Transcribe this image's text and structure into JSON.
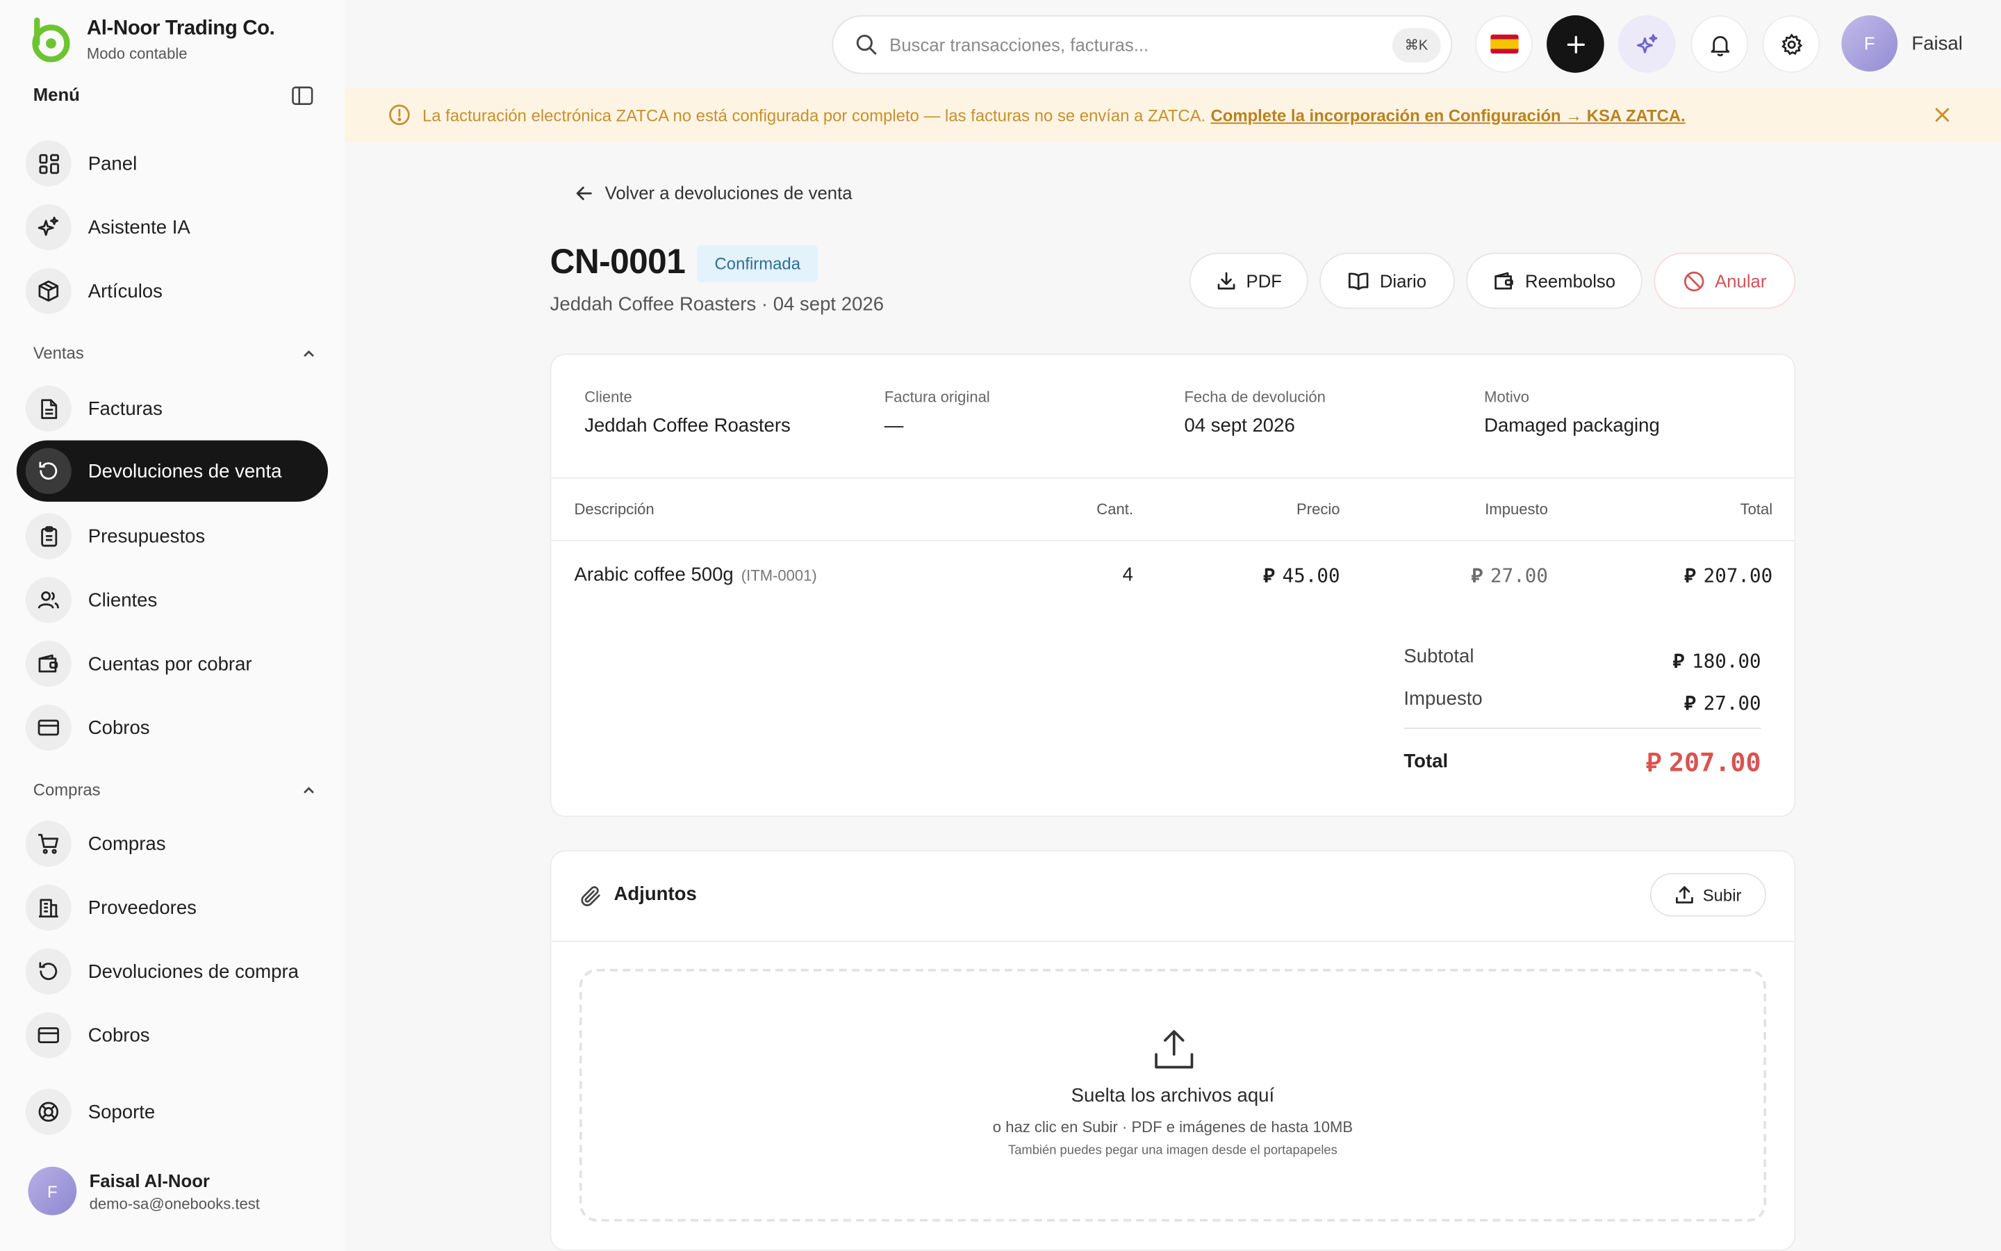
{
  "brand": {
    "name": "Al-Noor Trading Co.",
    "mode": "Modo contable"
  },
  "sidebar": {
    "menu_title": "Menú",
    "top_items": [
      {
        "label": "Panel",
        "icon": "grid-icon"
      },
      {
        "label": "Asistente IA",
        "icon": "sparkles-icon"
      },
      {
        "label": "Artículos",
        "icon": "box-icon"
      }
    ],
    "sales": {
      "title": "Ventas",
      "items": [
        {
          "label": "Facturas",
          "icon": "file-icon"
        },
        {
          "label": "Devoluciones de venta",
          "icon": "return-icon",
          "active": true
        },
        {
          "label": "Presupuestos",
          "icon": "clipboard-icon"
        },
        {
          "label": "Clientes",
          "icon": "users-icon"
        },
        {
          "label": "Cuentas por cobrar",
          "icon": "wallet-icon"
        },
        {
          "label": "Cobros",
          "icon": "card-icon"
        }
      ]
    },
    "purchases": {
      "title": "Compras",
      "items": [
        {
          "label": "Compras",
          "icon": "cart-icon"
        },
        {
          "label": "Proveedores",
          "icon": "building-icon"
        },
        {
          "label": "Devoluciones de compra",
          "icon": "return-icon"
        },
        {
          "label": "Cobros",
          "icon": "card-icon"
        }
      ]
    },
    "support": {
      "label": "Soporte",
      "icon": "lifebuoy-icon"
    },
    "user": {
      "initial": "F",
      "name": "Faisal Al-Noor",
      "email": "demo-sa@onebooks.test"
    }
  },
  "topbar": {
    "search_placeholder": "Buscar transacciones, facturas...",
    "shortcut": "⌘K",
    "profile": {
      "initial": "F",
      "name": "Faisal"
    }
  },
  "banner": {
    "text": "La facturación electrónica ZATCA no está configurada por completo — las facturas no se envían a ZATCA.",
    "link": "Complete la incorporación en Configuración → KSA ZATCA."
  },
  "doc": {
    "back": "Volver a devoluciones de venta",
    "number": "CN-0001",
    "status": "Confirmada",
    "subtitle": "Jeddah Coffee Roasters · 04 sept 2026",
    "actions": {
      "pdf": "PDF",
      "journal": "Diario",
      "refund": "Reembolso",
      "void": "Anular"
    },
    "meta": [
      {
        "label": "Cliente",
        "value": "Jeddah Coffee Roasters"
      },
      {
        "label": "Factura original",
        "value": "—"
      },
      {
        "label": "Fecha de devolución",
        "value": "04 sept 2026"
      },
      {
        "label": "Motivo",
        "value": "Damaged packaging"
      }
    ],
    "table": {
      "headers": {
        "description": "Descripción",
        "qty": "Cant.",
        "price": "Precio",
        "tax": "Impuesto",
        "total": "Total"
      },
      "rows": [
        {
          "description": "Arabic coffee 500g",
          "sku": "(ITM-0001)",
          "qty": "4",
          "price": "45.00",
          "tax": "27.00",
          "total": "207.00"
        }
      ]
    },
    "currency_symbol": "⃁",
    "totals": {
      "subtotal_label": "Subtotal",
      "subtotal": "180.00",
      "tax_label": "Impuesto",
      "tax": "27.00",
      "total_label": "Total",
      "total": "207.00"
    }
  },
  "attachments": {
    "title": "Adjuntos",
    "upload": "Subir",
    "drop_title": "Suelta los archivos aquí",
    "drop_sub": "o haz clic en Subir · PDF e imágenes de hasta 10MB",
    "drop_hint": "También puedes pegar una imagen desde el portapapeles"
  },
  "colors": {
    "accent_green": "#6cc530",
    "danger": "#d9534f",
    "banner_bg": "#fdf4e4",
    "banner_text": "#c8902c",
    "status_bg": "#e4f2fb"
  }
}
